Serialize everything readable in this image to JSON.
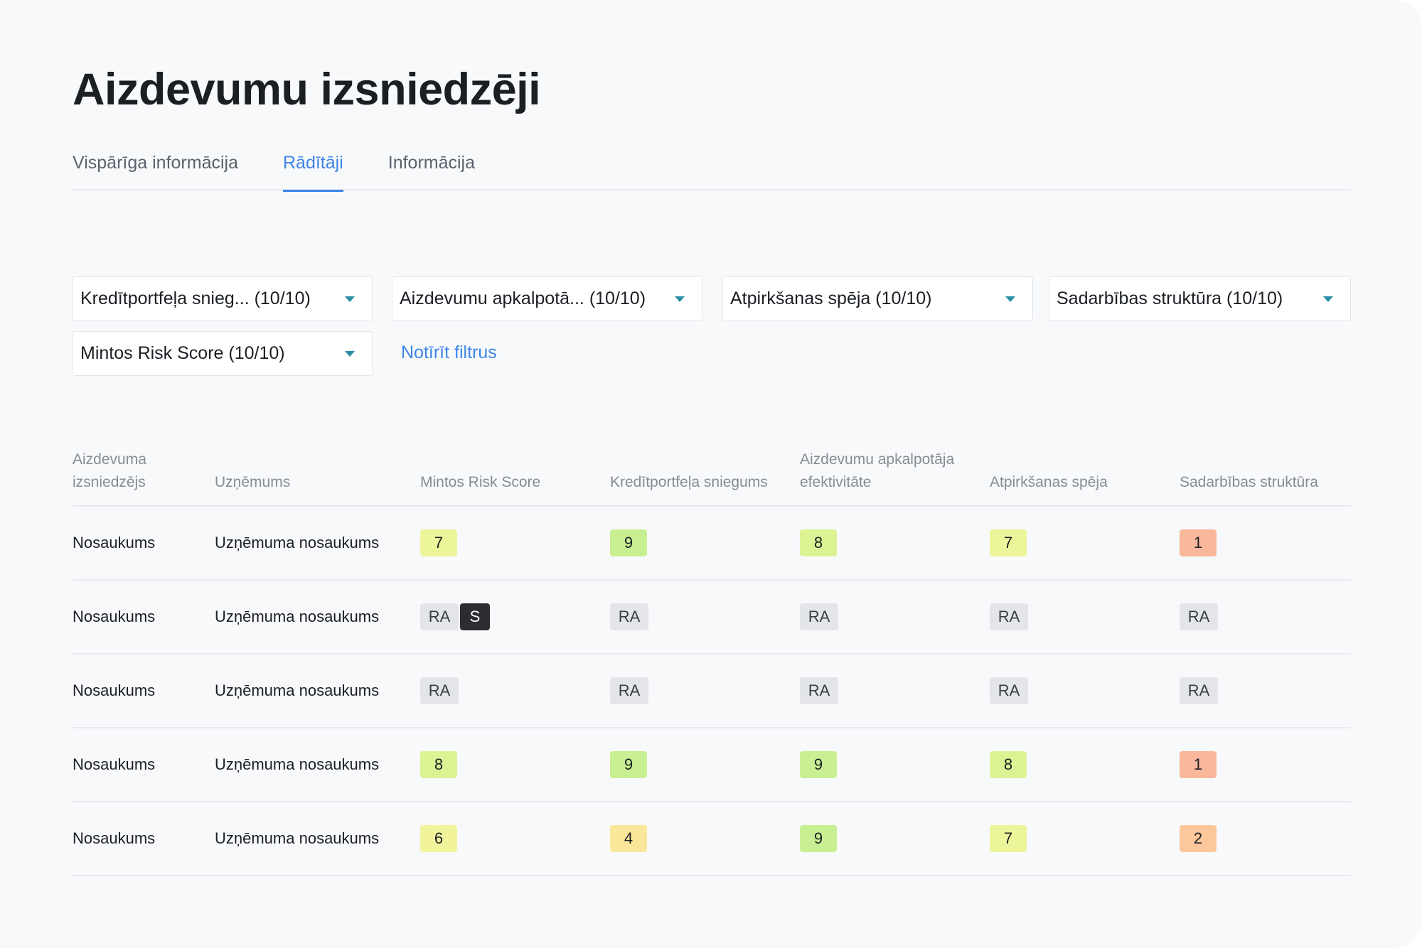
{
  "page_title": "Aizdevumu izsniedzēji",
  "tabs": [
    {
      "label": "Vispārīga informācija",
      "active": false
    },
    {
      "label": "Rādītāji",
      "active": true
    },
    {
      "label": "Informācija",
      "active": false
    }
  ],
  "filters": [
    {
      "label": "Kredītportfeļa snieg... (10/10)"
    },
    {
      "label": "Aizdevumu apkalpotā... (10/10)"
    },
    {
      "label": "Atpirkšanas spēja (10/10)"
    },
    {
      "label": "Sadarbības struktūra (10/10)"
    },
    {
      "label": "Mintos Risk Score (10/10)"
    }
  ],
  "clear_filters_label": "Notīrīt filtrus",
  "table": {
    "headers": [
      "Aizdevuma izsniedzējs",
      "Uzņēmums",
      "Mintos Risk Score",
      "Kredītportfeļa sniegums",
      "Aizdevumu apkalpotāja efektivitāte",
      "Atpirkšanas spēja",
      "Sadarbības struktūra"
    ],
    "rows": [
      {
        "lender": "Nosaukums",
        "company": "Uzņēmuma nosaukums",
        "scores": [
          "7",
          "9",
          "8",
          "7",
          "1"
        ],
        "extra_tag": ""
      },
      {
        "lender": "Nosaukums",
        "company": "Uzņēmuma nosaukums",
        "scores": [
          "RA",
          "RA",
          "RA",
          "RA",
          "RA"
        ],
        "extra_tag": "S"
      },
      {
        "lender": "Nosaukums",
        "company": "Uzņēmuma nosaukums",
        "scores": [
          "RA",
          "RA",
          "RA",
          "RA",
          "RA"
        ],
        "extra_tag": ""
      },
      {
        "lender": "Nosaukums",
        "company": "Uzņēmuma nosaukums",
        "scores": [
          "8",
          "9",
          "9",
          "8",
          "1"
        ],
        "extra_tag": ""
      },
      {
        "lender": "Nosaukums",
        "company": "Uzņēmuma nosaukums",
        "scores": [
          "6",
          "4",
          "9",
          "7",
          "2"
        ],
        "extra_tag": ""
      }
    ]
  },
  "score_colors": {
    "9": "#c9ef93",
    "8": "#dcf394",
    "7": "#ecf59a",
    "6": "#f1f49b",
    "4": "#fbe79a",
    "2": "#fcc79a",
    "1": "#f9b79c",
    "RA": "#e3e5e9"
  }
}
